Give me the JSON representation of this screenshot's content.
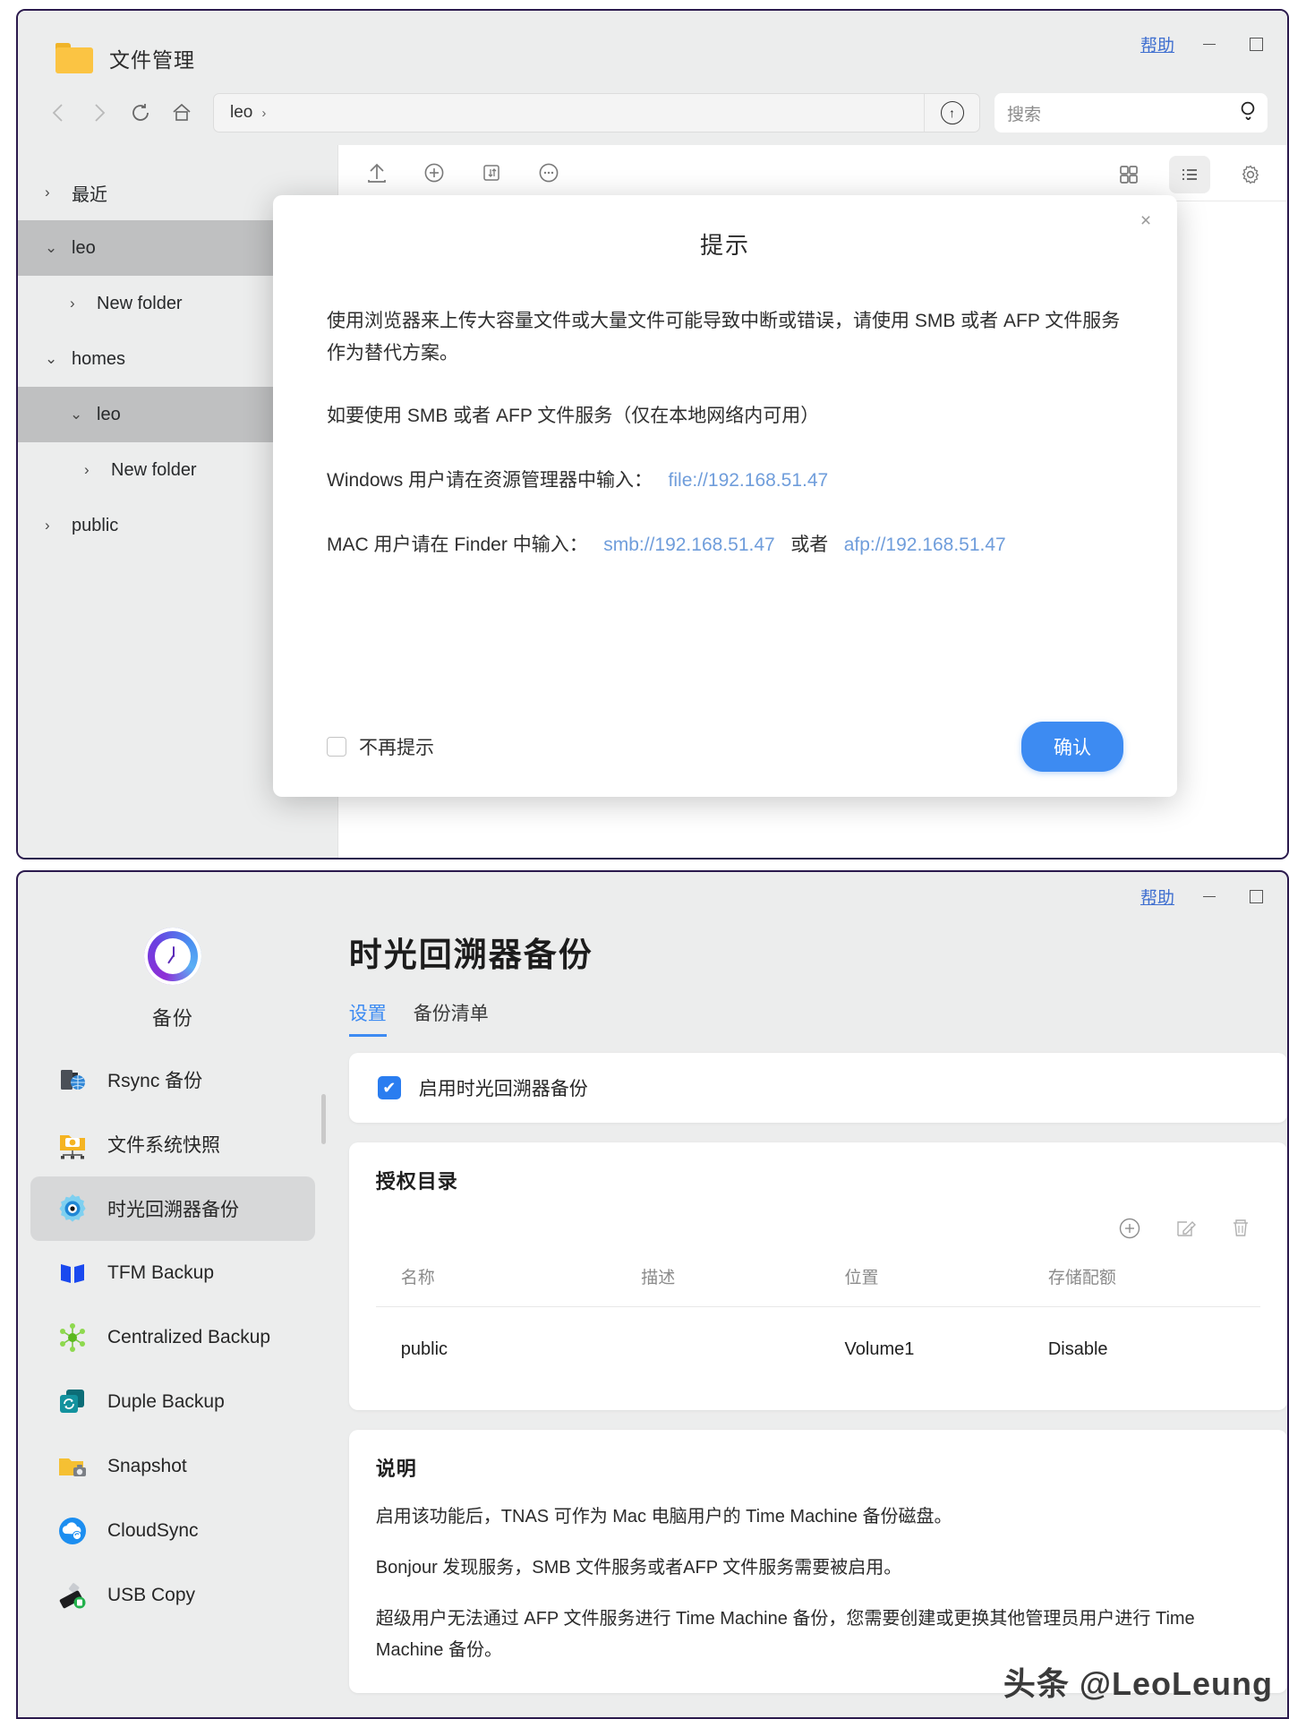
{
  "window1": {
    "app_title": "文件管理",
    "help_label": "帮助",
    "nav": {
      "back": "‹",
      "forward": "›",
      "refresh": "↻",
      "home": "⌂",
      "path_crumb": "leo",
      "path_chevron": "›",
      "upload_label": "↑"
    },
    "search": {
      "placeholder": "搜索"
    },
    "sidebar": [
      {
        "label": "最近",
        "twisty": "›",
        "level": 1,
        "selected": false
      },
      {
        "label": "leo",
        "twisty": "⌄",
        "level": 1,
        "selected": true
      },
      {
        "label": "New folder",
        "twisty": "›",
        "level": 2,
        "selected": false
      },
      {
        "label": "homes",
        "twisty": "⌄",
        "level": 1,
        "selected": false
      },
      {
        "label": "leo",
        "twisty": "⌄",
        "level": 2,
        "selected": true
      },
      {
        "label": "New folder",
        "twisty": "›",
        "level": 3,
        "selected": false
      },
      {
        "label": "public",
        "twisty": "›",
        "level": 1,
        "selected": false
      }
    ],
    "maintoolbar": {
      "upload": "upload-icon",
      "add": "plus-circle-icon",
      "sort": "sort-icon",
      "more": "more-icon",
      "grid_view": "grid-view-icon",
      "list_view": "list-view-icon",
      "settings": "gear-icon"
    }
  },
  "dialog": {
    "title": "提示",
    "close": "×",
    "paragraphs": [
      "使用浏览器来上传大容量文件或大量文件可能导致中断或错误，请使用 SMB 或者 AFP 文件服务作为替代方案。",
      "如要使用 SMB 或者 AFP 文件服务（仅在本地网络内可用）"
    ],
    "windows_line": {
      "prefix": "Windows 用户请在资源管理器中输入：",
      "link": "file://192.168.51.47"
    },
    "mac_line": {
      "prefix": "MAC 用户请在 Finder 中输入：",
      "link1": "smb://192.168.51.47",
      "middle": "或者",
      "link2": "afp://192.168.51.47"
    },
    "dont_show_label": "不再提示",
    "confirm_label": "确认"
  },
  "window2": {
    "help_label": "帮助",
    "app_name": "备份",
    "sidebar": [
      {
        "label": "Rsync 备份",
        "icon": "server-globe-icon",
        "selected": false
      },
      {
        "label": "文件系统快照",
        "icon": "folder-camera-net-icon",
        "selected": false
      },
      {
        "label": "时光回溯器备份",
        "icon": "time-machine-icon",
        "selected": true
      },
      {
        "label": "TFM Backup",
        "icon": "tfm-book-icon",
        "selected": false
      },
      {
        "label": "Centralized Backup",
        "icon": "centralized-nodes-icon",
        "selected": false
      },
      {
        "label": "Duple Backup",
        "icon": "duple-sync-icon",
        "selected": false
      },
      {
        "label": "Snapshot",
        "icon": "folder-camera-icon",
        "selected": false
      },
      {
        "label": "CloudSync",
        "icon": "cloud-sync-icon",
        "selected": false
      },
      {
        "label": "USB Copy",
        "icon": "usb-copy-icon",
        "selected": false
      }
    ],
    "page_title": "时光回溯器备份",
    "tabs": [
      {
        "label": "设置",
        "active": true
      },
      {
        "label": "备份清单",
        "active": false
      }
    ],
    "enable": {
      "label": "启用时光回溯器备份",
      "checked": true,
      "check_glyph": "✔"
    },
    "dirs_card": {
      "heading": "授权目录",
      "actions": {
        "add": "plus-circle-icon",
        "edit": "edit-icon",
        "delete": "trash-icon"
      },
      "columns": [
        "名称",
        "描述",
        "位置",
        "存储配额"
      ],
      "rows": [
        {
          "name": "public",
          "desc": "",
          "location": "Volume1",
          "quota": "Disable"
        }
      ]
    },
    "desc_card": {
      "heading": "说明",
      "paragraphs": [
        "启用该功能后，TNAS 可作为 Mac 电脑用户的 Time Machine 备份磁盘。",
        "Bonjour 发现服务，SMB 文件服务或者AFP 文件服务需要被启用。",
        "超级用户无法通过 AFP 文件服务进行 Time Machine 备份，您需要创建或更换其他管理员用户进行 Time Machine 备份。"
      ]
    }
  },
  "watermark": "头条 @LeoLeung",
  "colors": {
    "accent": "#3d8bf2",
    "link": "#3f6fd0",
    "window_border": "#2b1a4d",
    "selection": "#bfc0c1"
  }
}
